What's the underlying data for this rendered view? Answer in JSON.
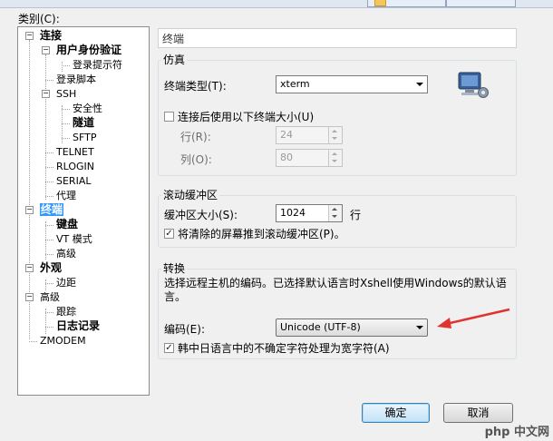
{
  "dialog": {
    "category_label": "类别(C):",
    "ok_label": "确定",
    "cancel_label": "取消"
  },
  "tree": {
    "items": [
      {
        "label": "连接",
        "bold": true,
        "level": 0,
        "expander": "−"
      },
      {
        "label": "用户身份验证",
        "bold": true,
        "level": 1,
        "expander": "−"
      },
      {
        "label": "登录提示符",
        "bold": false,
        "level": 2
      },
      {
        "label": "登录脚本",
        "bold": false,
        "level": 1
      },
      {
        "label": "SSH",
        "bold": false,
        "level": 1,
        "expander": "−"
      },
      {
        "label": "安全性",
        "bold": false,
        "level": 2
      },
      {
        "label": "隧道",
        "bold": true,
        "level": 2
      },
      {
        "label": "SFTP",
        "bold": false,
        "level": 2
      },
      {
        "label": "TELNET",
        "bold": false,
        "level": 1
      },
      {
        "label": "RLOGIN",
        "bold": false,
        "level": 1
      },
      {
        "label": "SERIAL",
        "bold": false,
        "level": 1
      },
      {
        "label": "代理",
        "bold": false,
        "level": 1
      },
      {
        "label": "终端",
        "bold": true,
        "level": 0,
        "expander": "−",
        "selected": true
      },
      {
        "label": "键盘",
        "bold": true,
        "level": 1
      },
      {
        "label": "VT 模式",
        "bold": false,
        "level": 1
      },
      {
        "label": "高级",
        "bold": false,
        "level": 1
      },
      {
        "label": "外观",
        "bold": true,
        "level": 0,
        "expander": "−"
      },
      {
        "label": "边距",
        "bold": false,
        "level": 1
      },
      {
        "label": "高级",
        "bold": false,
        "level": 0,
        "expander": "−"
      },
      {
        "label": "跟踪",
        "bold": false,
        "level": 1
      },
      {
        "label": "日志记录",
        "bold": true,
        "level": 1
      },
      {
        "label": "ZMODEM",
        "bold": false,
        "level": 0
      }
    ]
  },
  "panel": {
    "header": "终端",
    "emulation": {
      "title": "仿真",
      "terminal_type_label": "终端类型(T):",
      "terminal_type_value": "xterm",
      "resize_checkbox_label": "连接后使用以下终端大小(U)",
      "resize_checked": false,
      "rows_label": "行(R):",
      "rows_value": "24",
      "cols_label": "列(O):",
      "cols_value": "80"
    },
    "scrollback": {
      "title": "滚动缓冲区",
      "buffer_size_label": "缓冲区大小(S):",
      "buffer_size_value": "1024",
      "buffer_unit": "行",
      "push_cleared_label": "将清除的屏幕推到滚动缓冲区(P)。",
      "push_cleared_checked": true
    },
    "translation": {
      "title": "转换",
      "description": "选择远程主机的编码。已选择默认语言时Xshell使用Windows的默认语言。",
      "encoding_label": "编码(E):",
      "encoding_value": "Unicode (UTF-8)",
      "cjk_checkbox_label": "韩中日语言中的不确定字符处理为宽字符(A)",
      "cjk_checked": true
    }
  },
  "watermark": "php 中文网",
  "colors": {
    "selection": "#3399ff",
    "arrow": "#e0332f"
  }
}
